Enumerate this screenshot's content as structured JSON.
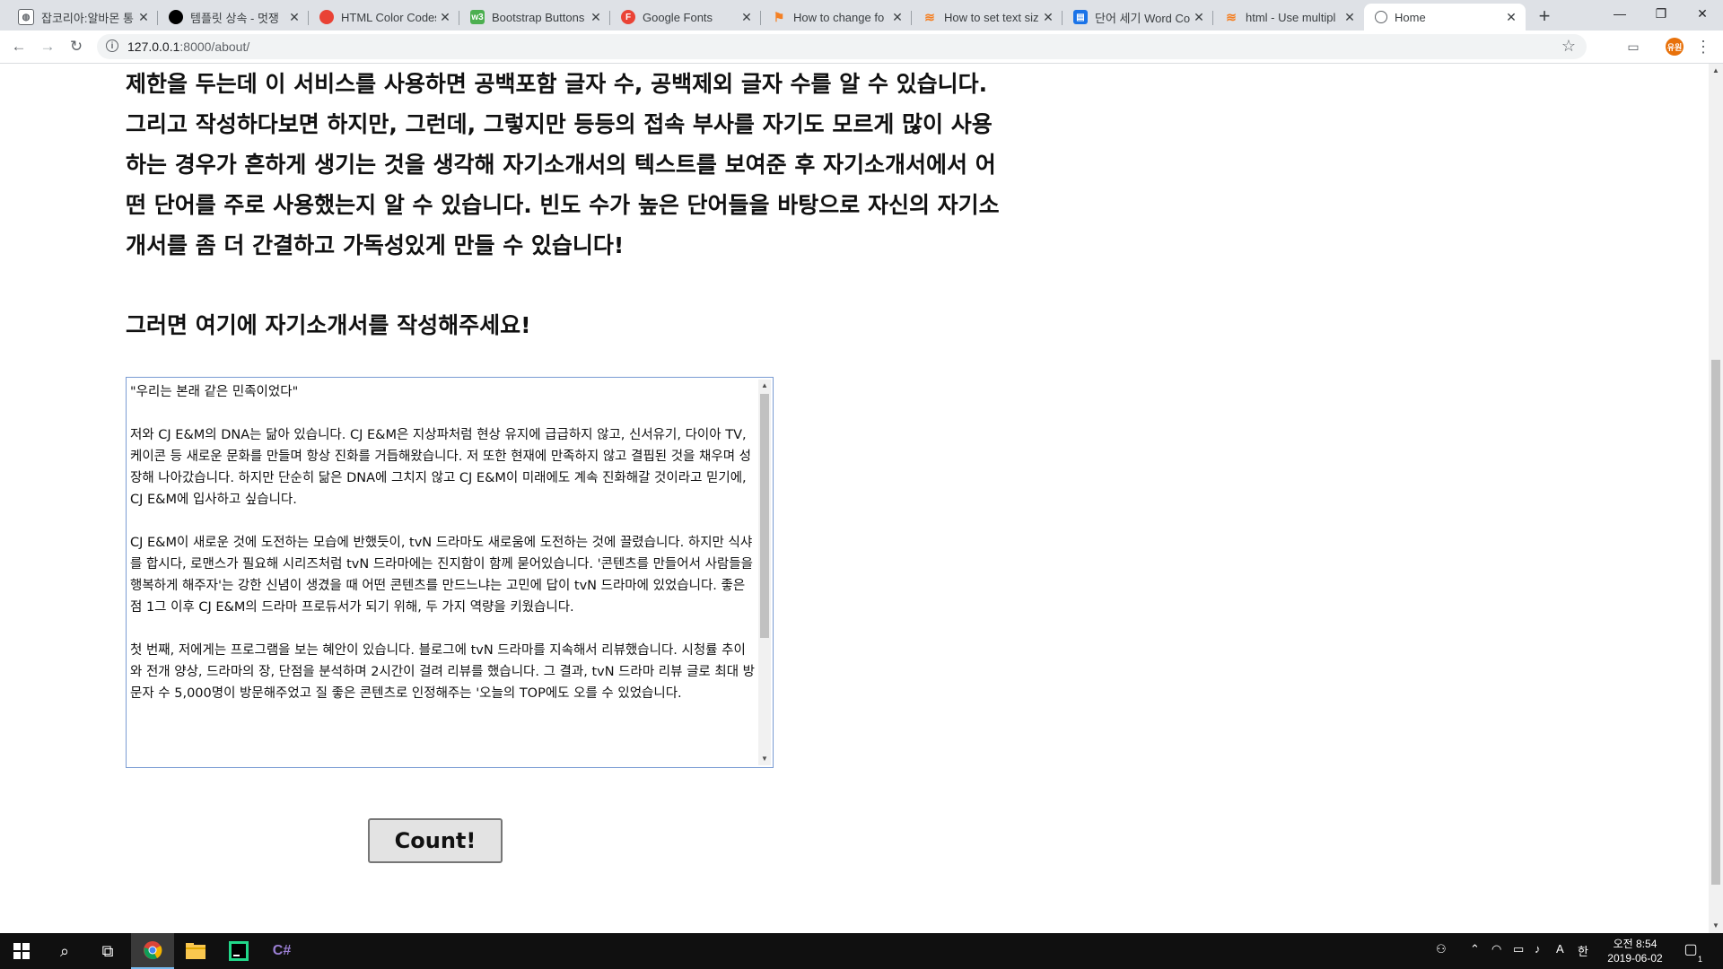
{
  "browser": {
    "tabs": [
      {
        "title": "잡코리아:알바몬 통",
        "favicon_color": "#ffffff",
        "favicon_glyph": "globe-icon"
      },
      {
        "title": "템플릿 상속 - 멋쟁",
        "favicon_color": "#000000",
        "favicon_glyph": "circle-icon"
      },
      {
        "title": "HTML Color Codes",
        "favicon_color": "#e94235",
        "favicon_glyph": "color-wheel-icon"
      },
      {
        "title": "Bootstrap Buttons",
        "favicon_color": "#4caf50",
        "favicon_glyph": "w3-icon"
      },
      {
        "title": "Google Fonts",
        "favicon_color": "#ea4335",
        "favicon_glyph": "F"
      },
      {
        "title": "How to change fo",
        "favicon_color": "#f48024",
        "favicon_glyph": "flag-icon"
      },
      {
        "title": "How to set text siz",
        "favicon_color": "#f48024",
        "favicon_glyph": "stack-icon"
      },
      {
        "title": "단어 세기 Word Co",
        "favicon_color": "#1a73e8",
        "favicon_glyph": "doc-icon"
      },
      {
        "title": "html - Use multipl",
        "favicon_color": "#f48024",
        "favicon_glyph": "stack-icon"
      },
      {
        "title": "Home",
        "favicon_color": "#5f6368",
        "favicon_glyph": "globe-icon"
      }
    ],
    "active_tab_index": 9,
    "new_tab_label": "+",
    "url_host": "127.0.0.1",
    "url_rest": ":8000/about/",
    "avatar_label": "유원"
  },
  "page": {
    "intro_text": "제한을 두는데 이 서비스를 사용하면 공백포함 글자 수, 공백제외 글자 수를 알 수 있습니다. 그리고 작성하다보면 하지만, 그런데, 그렇지만 등등의 접속 부사를 자기도 모르게 많이 사용하는 경우가 흔하게 생기는 것을 생각해 자기소개서의 텍스트를 보여준 후 자기소개서에서 어떤 단어를 주로 사용했는지 알 수 있습니다. 빈도 수가 높은 단어들을 바탕으로 자신의 자기소개서를 좀 더 간결하고 가독성있게 만들 수 있습니다!",
    "prompt": "그러면 여기에 자기소개서를 작성해주세요!",
    "essay_text": "\"우리는 본래 같은 민족이었다\"\n\n저와 CJ E&M의 DNA는 닮아 있습니다. CJ E&M은 지상파처럼 현상 유지에 급급하지 않고, 신서유기, 다이아 TV, 케이콘 등 새로운 문화를 만들며 항상 진화를 거듭해왔습니다. 저 또한 현재에 만족하지 않고 결핍된 것을 채우며 성장해 나아갔습니다. 하지만 단순히 닮은 DNA에 그치지 않고 CJ E&M이 미래에도 계속 진화해갈 것이라고 믿기에, CJ E&M에 입사하고 싶습니다.\n\nCJ E&M이 새로운 것에 도전하는 모습에 반했듯이, tvN 드라마도 새로움에 도전하는 것에 끌렸습니다. 하지만 식샤를 합시다, 로맨스가 필요해 시리즈처럼 tvN 드라마에는 진지함이 함께 묻어있습니다. '콘텐츠를 만들어서 사람들을 행복하게 해주자'는 강한 신념이 생겼을 때 어떤 콘텐츠를 만드느냐는 고민에 답이 tvN 드라마에 있었습니다. 좋은점 1그 이후 CJ E&M의 드라마 프로듀서가 되기 위해, 두 가지 역량을 키웠습니다.\n\n첫 번째, 저에게는 프로그램을 보는 혜안이 있습니다. 블로그에 tvN 드라마를 지속해서 리뷰했습니다. 시청률 추이와 전개 양상, 드라마의 장, 단점을 분석하며 2시간이 걸려 리뷰를 했습니다. 그 결과, tvN 드라마 리뷰 글로 최대 방문자 수 5,000명이 방문해주었고 질 좋은 콘텐츠로 인정해주는 '오늘의 TOP에도 오를 수 있었습니다.",
    "count_button": "Count!"
  },
  "taskbar": {
    "clock_time": "오전 8:54",
    "clock_date": "2019-06-02",
    "ime_label": "A",
    "notification_count": "1"
  }
}
